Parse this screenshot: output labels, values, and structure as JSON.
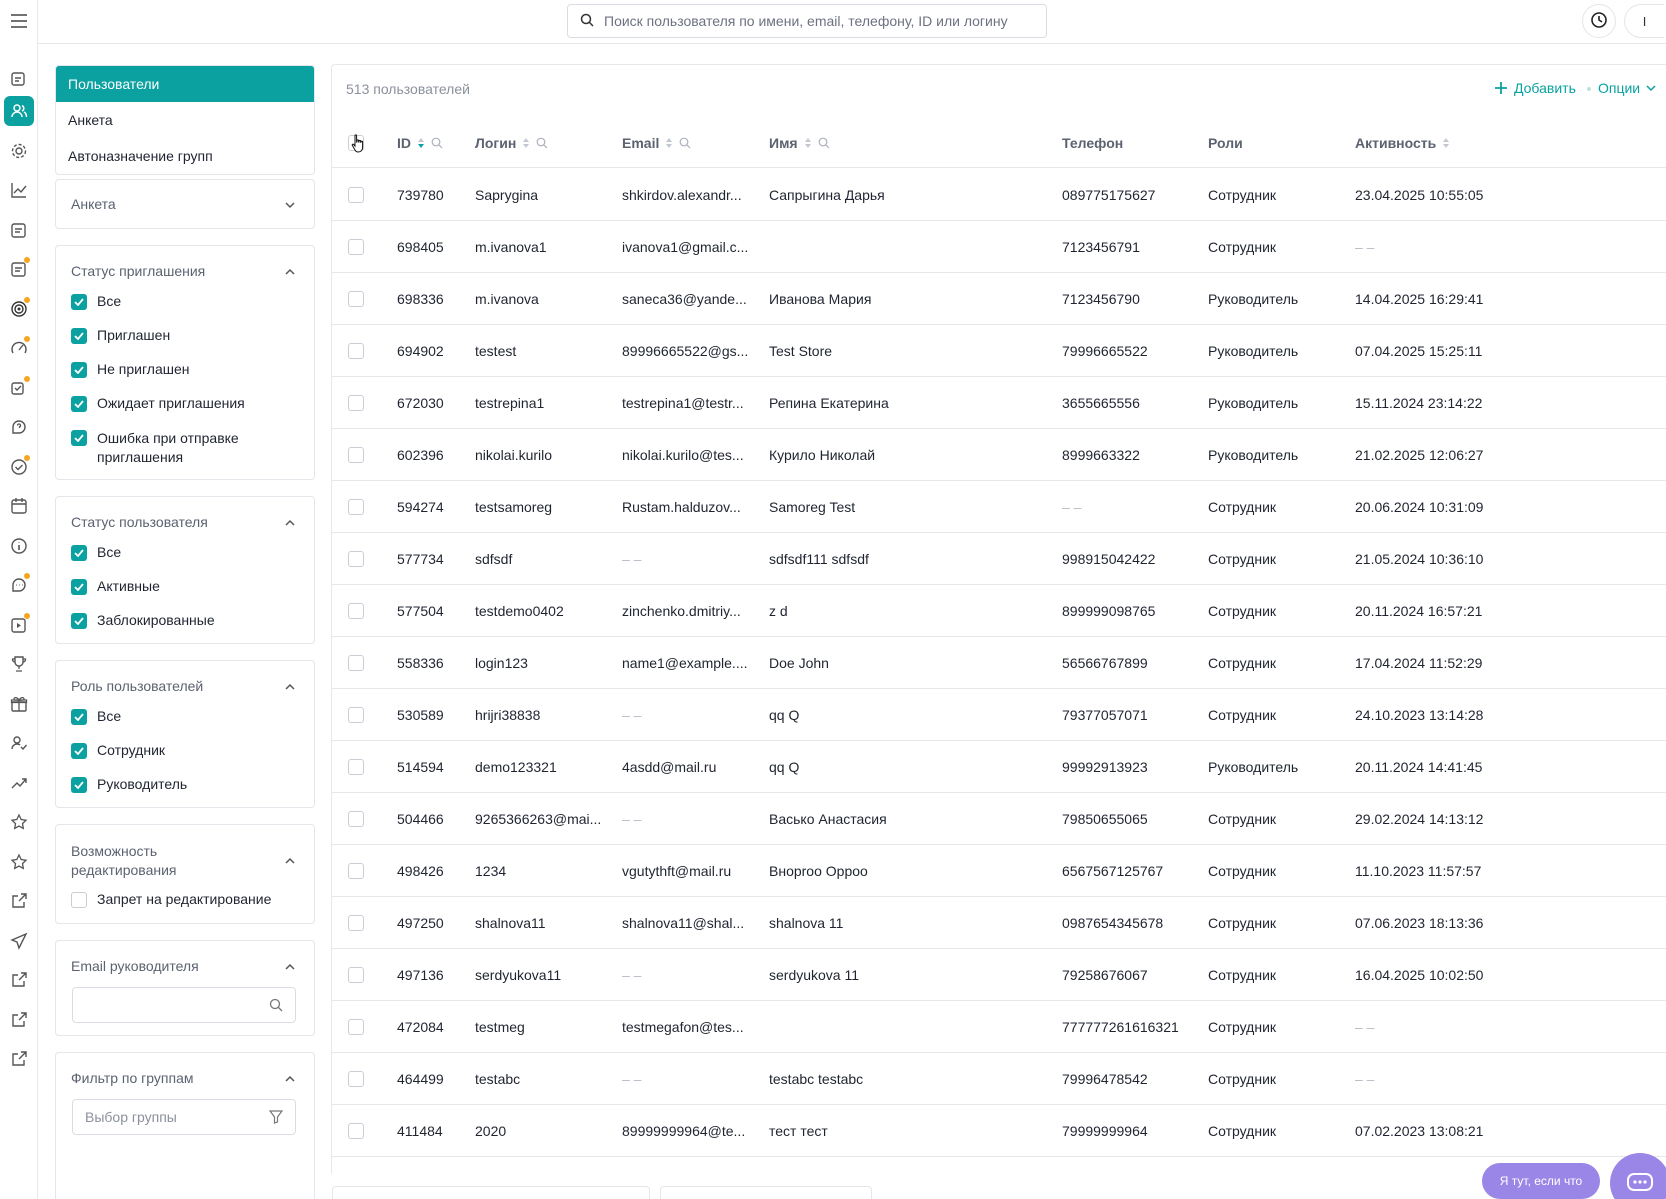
{
  "search": {
    "placeholder": "Поиск пользователя по имени, email, телефону, ID или логину"
  },
  "header": {
    "avatar_initial": "I"
  },
  "nav": [
    {
      "label": "Пользователи",
      "active": true
    },
    {
      "label": "Анкета",
      "active": false
    },
    {
      "label": "Автоназначение групп",
      "active": false
    }
  ],
  "filters": {
    "anketa": {
      "title": "Анкета"
    },
    "invite_status": {
      "title": "Статус приглашения",
      "options": [
        "Все",
        "Приглашен",
        "Не приглашен",
        "Ожидает приглашения",
        "Ошибка при отправке приглашения"
      ]
    },
    "user_status": {
      "title": "Статус пользователя",
      "options": [
        "Все",
        "Активные",
        "Заблокированные"
      ]
    },
    "user_role": {
      "title": "Роль пользователей",
      "options": [
        "Все",
        "Сотрудник",
        "Руководитель"
      ]
    },
    "edit_ability": {
      "title": "Возможность редактирования",
      "option": "Запрет на редактирование"
    },
    "manager_email": {
      "title": "Email руководителя",
      "placeholder": ""
    },
    "groups": {
      "title": "Фильтр по группам",
      "placeholder": "Выбор группы"
    }
  },
  "table": {
    "count_label": "513 пользователей",
    "add_label": "Добавить",
    "options_label": "Опции",
    "columns": {
      "id": "ID",
      "login": "Логин",
      "email": "Email",
      "name": "Имя",
      "phone": "Телефон",
      "roles": "Роли",
      "activity": "Активность"
    },
    "rows": [
      {
        "id": "739780",
        "login": "Saprygina",
        "email": "shkirdov.alexandr...",
        "name": "Сапрыгина Дарья",
        "phone": "089775175627",
        "role": "Сотрудник",
        "activity": "23.04.2025 10:55:05"
      },
      {
        "id": "698405",
        "login": "m.ivanova1",
        "email": "ivanova1@gmail.c...",
        "name": "",
        "phone": "7123456791",
        "role": "Сотрудник",
        "activity": "– –"
      },
      {
        "id": "698336",
        "login": "m.ivanova",
        "email": "saneca36@yande...",
        "name": "Иванова Мария",
        "phone": "7123456790",
        "role": "Руководитель",
        "activity": "14.04.2025 16:29:41"
      },
      {
        "id": "694902",
        "login": "testest",
        "email": "89996665522@gs...",
        "name": "Test Store",
        "phone": "79996665522",
        "role": "Руководитель",
        "activity": "07.04.2025 15:25:11"
      },
      {
        "id": "672030",
        "login": "testrepina1",
        "email": "testrepina1@testr...",
        "name": "Репина Екатерина",
        "phone": "3655665556",
        "role": "Руководитель",
        "activity": "15.11.2024 23:14:22"
      },
      {
        "id": "602396",
        "login": "nikolai.kurilo",
        "email": "nikolai.kurilo@tes...",
        "name": "Курило Николай",
        "phone": "8999663322",
        "role": "Руководитель",
        "activity": "21.02.2025 12:06:27"
      },
      {
        "id": "594274",
        "login": "testsamoreg",
        "email": "Rustam.halduzov...",
        "name": "Samoreg Test",
        "phone": "– –",
        "role": "Сотрудник",
        "activity": "20.06.2024 10:31:09"
      },
      {
        "id": "577734",
        "login": "sdfsdf",
        "email": "– –",
        "name": "sdfsdf111 sdfsdf",
        "phone": "998915042422",
        "role": "Сотрудник",
        "activity": "21.05.2024 10:36:10"
      },
      {
        "id": "577504",
        "login": "testdemo0402",
        "email": "zinchenko.dmitriy...",
        "name": "z d",
        "phone": "899999098765",
        "role": "Сотрудник",
        "activity": "20.11.2024 16:57:21"
      },
      {
        "id": "558336",
        "login": "login123",
        "email": "name1@example....",
        "name": "Doe John",
        "phone": "56566767899",
        "role": "Сотрудник",
        "activity": "17.04.2024 11:52:29"
      },
      {
        "id": "530589",
        "login": "hrijri38838",
        "email": "– –",
        "name": "qq Q",
        "phone": "79377057071",
        "role": "Сотрудник",
        "activity": "24.10.2023 13:14:28"
      },
      {
        "id": "514594",
        "login": "demo123321",
        "email": "4asdd@mail.ru",
        "name": "qq Q",
        "phone": "99992913923",
        "role": "Руководитель",
        "activity": "20.11.2024 14:41:45"
      },
      {
        "id": "504466",
        "login": "9265366263@mai...",
        "email": "– –",
        "name": "Васько Анастасия",
        "phone": "79850655065",
        "role": "Сотрудник",
        "activity": "29.02.2024 14:13:12"
      },
      {
        "id": "498426",
        "login": "1234",
        "email": "vgutythft@mail.ru",
        "name": "Внорroo Орроо",
        "phone": "6567567125767",
        "role": "Сотрудник",
        "activity": "11.10.2023 11:57:57"
      },
      {
        "id": "497250",
        "login": "shalnova11",
        "email": "shalnova11@shal...",
        "name": "shalnova 11",
        "phone": "0987654345678",
        "role": "Сотрудник",
        "activity": "07.06.2023 18:13:36"
      },
      {
        "id": "497136",
        "login": "serdyukova11",
        "email": "– –",
        "name": "serdyukova 11",
        "phone": "79258676067",
        "role": "Сотрудник",
        "activity": "16.04.2025 10:02:50"
      },
      {
        "id": "472084",
        "login": "testmeg",
        "email": "testmegafon@tes...",
        "name": "",
        "phone": "777777261616321",
        "role": "Сотрудник",
        "activity": "– –"
      },
      {
        "id": "464499",
        "login": "testabc",
        "email": "– –",
        "name": "testabc testabc",
        "phone": "79996478542",
        "role": "Сотрудник",
        "activity": "– –"
      },
      {
        "id": "411484",
        "login": "2020",
        "email": "89999999964@te...",
        "name": "тест тест",
        "phone": "79999999964",
        "role": "Сотрудник",
        "activity": "07.02.2023 13:08:21"
      }
    ]
  },
  "chat": {
    "bubble": "Я тут, если что"
  },
  "colors": {
    "accent": "#0aa1a0",
    "chat": "#9a86e6",
    "notify": "#f6a623"
  }
}
